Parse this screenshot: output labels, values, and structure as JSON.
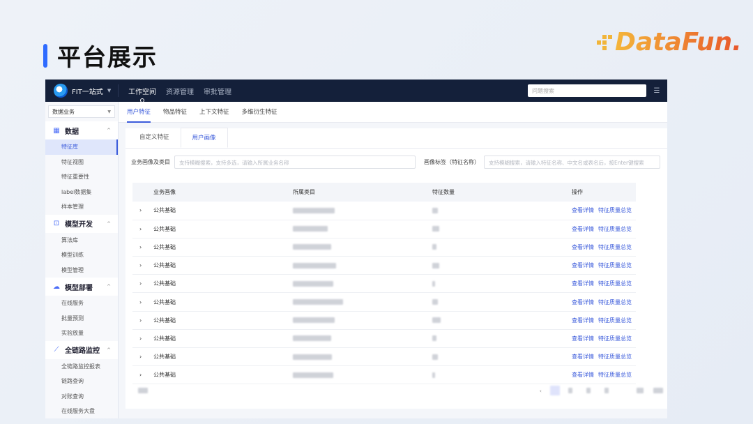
{
  "slide": {
    "title": "平台展示",
    "logo": "DataFun."
  },
  "topbar": {
    "brand": "FIT一站式",
    "nav": [
      "工作空间",
      "资源管理",
      "审批管理"
    ],
    "search_placeholder": "问题搜索"
  },
  "sidebar": {
    "select": "数据业务",
    "groups": [
      {
        "label": "数据",
        "icon": "table-icon",
        "items": [
          "特征库",
          "特征视图",
          "特征重要性",
          "label数据集",
          "样本管理"
        ]
      },
      {
        "label": "模型开发",
        "icon": "terminal-icon",
        "items": [
          "算法库",
          "模型训练",
          "模型管理"
        ]
      },
      {
        "label": "模型部署",
        "icon": "cloud-icon",
        "items": [
          "在线服务",
          "批量预测",
          "实验放量"
        ]
      },
      {
        "label": "全链路监控",
        "icon": "chart-line-icon",
        "items": [
          "全链路监控报表",
          "链路查询",
          "对账查询",
          "在线服务大盘"
        ]
      }
    ]
  },
  "subtabs": [
    "用户特征",
    "物品特征",
    "上下文特征",
    "多维衍生特征"
  ],
  "panel_tabs": [
    "自定义特征",
    "用户画像"
  ],
  "filters": {
    "category_label": "业务画像及类目",
    "category_placeholder": "支持模糊搜索，支持多选，请输入所属业务名称",
    "tag_label": "画像标签（特征名称）",
    "tag_placeholder": "支持模糊搜索，请输入特征名称、中文名或表名后，按Enter键搜索"
  },
  "table": {
    "headers": [
      "业务画像",
      "所属类目",
      "特征数量",
      "操作"
    ],
    "rows": [
      {
        "profile": "公共基础"
      },
      {
        "profile": "公共基础"
      },
      {
        "profile": "公共基础"
      },
      {
        "profile": "公共基础"
      },
      {
        "profile": "公共基础"
      },
      {
        "profile": "公共基础"
      },
      {
        "profile": "公共基础"
      },
      {
        "profile": "公共基础"
      },
      {
        "profile": "公共基础"
      },
      {
        "profile": "公共基础"
      }
    ],
    "actions": [
      "查看详情",
      "特征质量总览"
    ]
  }
}
